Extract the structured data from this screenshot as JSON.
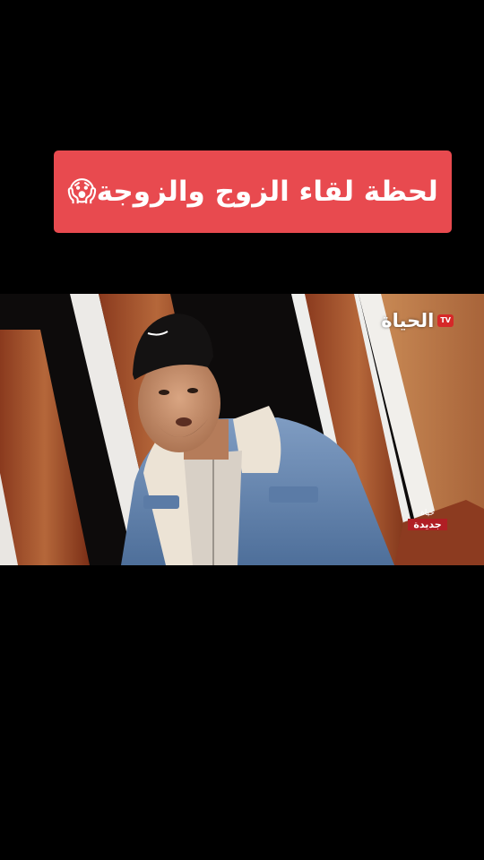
{
  "caption": {
    "text": "لحظة لقاء الزوج والزوجة😱"
  },
  "video": {
    "channel_logo_text": "الحياة",
    "channel_badge": "TV",
    "show_logo_line1": "حياة",
    "show_logo_line2": "جديدة"
  },
  "colors": {
    "banner": "#e84a4f",
    "background": "#000000",
    "jacket": "#6d8db5",
    "wood": "#b5673a"
  }
}
